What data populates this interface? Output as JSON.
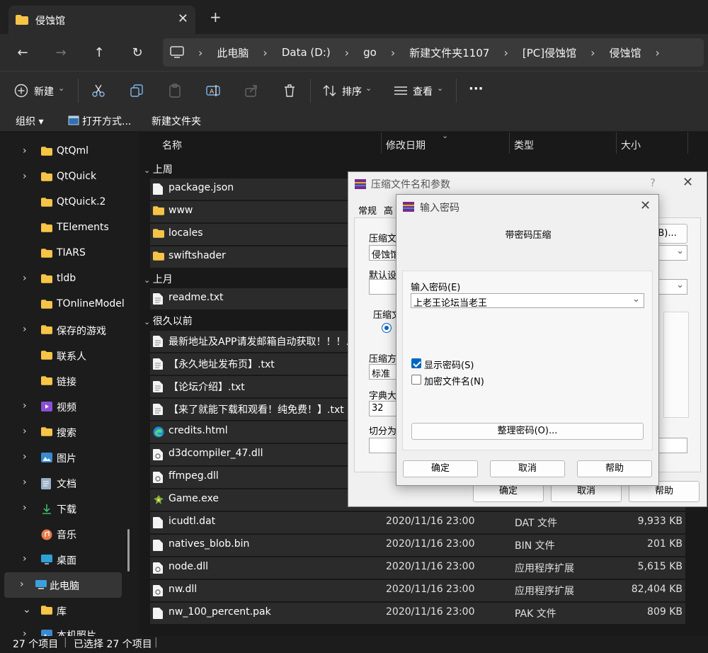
{
  "tab": {
    "title": "侵蚀馆",
    "close": "✕",
    "new": "+"
  },
  "nav": {
    "back": "←",
    "forward": "→",
    "up": "↑",
    "refresh": "↻",
    "breadcrumbs": [
      "此电脑",
      "Data (D:)",
      "go",
      "新建文件夹1107",
      "[PC]侵蚀馆",
      "侵蚀馆"
    ]
  },
  "toolbar": {
    "new": "新建",
    "sort": "排序",
    "view": "查看",
    "more": "···"
  },
  "commands": {
    "organize": "组织 ▾",
    "open_with": "打开方式...",
    "new_folder": "新建文件夹"
  },
  "sidebar": {
    "items": [
      {
        "label": "QtQml",
        "chevron": "›",
        "icon": "folder"
      },
      {
        "label": "QtQuick",
        "chevron": "›",
        "icon": "folder"
      },
      {
        "label": "QtQuick.2",
        "chevron": "",
        "icon": "folder"
      },
      {
        "label": "TElements",
        "chevron": "",
        "icon": "folder"
      },
      {
        "label": "TIARS",
        "chevron": "",
        "icon": "folder"
      },
      {
        "label": "tldb",
        "chevron": "›",
        "icon": "folder"
      },
      {
        "label": "TOnlineModel",
        "chevron": "",
        "icon": "folder"
      },
      {
        "label": "保存的游戏",
        "chevron": "›",
        "icon": "folder"
      },
      {
        "label": "联系人",
        "chevron": "",
        "icon": "folder"
      },
      {
        "label": "链接",
        "chevron": "",
        "icon": "folder"
      },
      {
        "label": "视频",
        "chevron": "›",
        "icon": "video"
      },
      {
        "label": "搜索",
        "chevron": "›",
        "icon": "folder"
      },
      {
        "label": "图片",
        "chevron": "›",
        "icon": "picture"
      },
      {
        "label": "文档",
        "chevron": "›",
        "icon": "document"
      },
      {
        "label": "下载",
        "chevron": "›",
        "icon": "download"
      },
      {
        "label": "音乐",
        "chevron": "",
        "icon": "music"
      },
      {
        "label": "桌面",
        "chevron": "›",
        "icon": "desktop"
      },
      {
        "label": "此电脑",
        "chevron": "›",
        "icon": "computer"
      },
      {
        "label": "库",
        "chevron": "⌄",
        "icon": "folder"
      },
      {
        "label": "本机照片",
        "chevron": "›",
        "icon": "picture"
      }
    ]
  },
  "columns": {
    "name": "名称",
    "date": "修改日期",
    "type": "类型",
    "size": "大小"
  },
  "groups": {
    "last_week": "上周",
    "last_month": "上月",
    "long_ago": "很久以前"
  },
  "files": [
    {
      "name": "package.json",
      "date": "",
      "type": "",
      "size": "",
      "icon": "file"
    },
    {
      "name": "www",
      "date": "",
      "type": "",
      "size": "",
      "icon": "folder"
    },
    {
      "name": "locales",
      "date": "",
      "type": "",
      "size": "",
      "icon": "folder"
    },
    {
      "name": "swiftshader",
      "date": "",
      "type": "",
      "size": "",
      "icon": "folder"
    },
    {
      "name": "readme.txt",
      "date": "",
      "type": "",
      "size": "",
      "icon": "text"
    },
    {
      "name": "最新地址及APP请发邮箱自动获取！！！.txt",
      "date": "",
      "type": "",
      "size": "",
      "icon": "text"
    },
    {
      "name": "【永久地址发布页】.txt",
      "date": "",
      "type": "",
      "size": "",
      "icon": "text"
    },
    {
      "name": "【论坛介绍】.txt",
      "date": "",
      "type": "",
      "size": "",
      "icon": "text"
    },
    {
      "name": "【来了就能下载和观看！纯免费！】.txt",
      "date": "",
      "type": "",
      "size": "",
      "icon": "text"
    },
    {
      "name": "credits.html",
      "date": "",
      "type": "",
      "size": "",
      "icon": "edge"
    },
    {
      "name": "d3dcompiler_47.dll",
      "date": "",
      "type": "",
      "size": "",
      "icon": "dll"
    },
    {
      "name": "ffmpeg.dll",
      "date": "",
      "type": "",
      "size": "",
      "icon": "dll"
    },
    {
      "name": "Game.exe",
      "date": "",
      "type": "",
      "size": "",
      "icon": "exe"
    },
    {
      "name": "icudtl.dat",
      "date": "2020/11/16 23:00",
      "type": "DAT 文件",
      "size": "9,933 KB",
      "icon": "file"
    },
    {
      "name": "natives_blob.bin",
      "date": "2020/11/16 23:00",
      "type": "BIN 文件",
      "size": "201 KB",
      "icon": "file"
    },
    {
      "name": "node.dll",
      "date": "2020/11/16 23:00",
      "type": "应用程序扩展",
      "size": "5,615 KB",
      "icon": "dll"
    },
    {
      "name": "nw.dll",
      "date": "2020/11/16 23:00",
      "type": "应用程序扩展",
      "size": "82,404 KB",
      "icon": "dll"
    },
    {
      "name": "nw_100_percent.pak",
      "date": "2020/11/16 23:00",
      "type": "PAK 文件",
      "size": "809 KB",
      "icon": "file"
    }
  ],
  "status": {
    "count": "27 个项目",
    "selected": "已选择 27 个项目"
  },
  "archive_dialog": {
    "title": "压缩文件名和参数",
    "help": "?",
    "close": "✕",
    "tab_general": "常规",
    "tab_advanced": "高",
    "archive_name_label": "压缩文",
    "archive_name_value": "侵蚀馆",
    "browse_button": "(B)...",
    "default_settings_label": "默认设置",
    "format_label": "压缩文",
    "method_label": "压缩方",
    "method_value": "标准",
    "dict_label": "字典大小",
    "dict_value": "32",
    "split_label": "切分为分",
    "ok": "确定",
    "cancel": "取消",
    "help_button": "帮助"
  },
  "password_dialog": {
    "title": "输入密码",
    "close": "✕",
    "heading": "带密码压缩",
    "password_label": "输入密码(E)",
    "password_value": "上老王论坛当老王",
    "show_password": "显示密码(S)",
    "encrypt_names": "加密文件名(N)",
    "organize_button": "整理密码(O)...",
    "ok": "确定",
    "cancel": "取消",
    "help": "帮助"
  },
  "colors": {
    "accent": "#0067c0",
    "folder": "#f6c447",
    "dark_bg": "#191919",
    "row_bg": "#2b2b2b"
  }
}
